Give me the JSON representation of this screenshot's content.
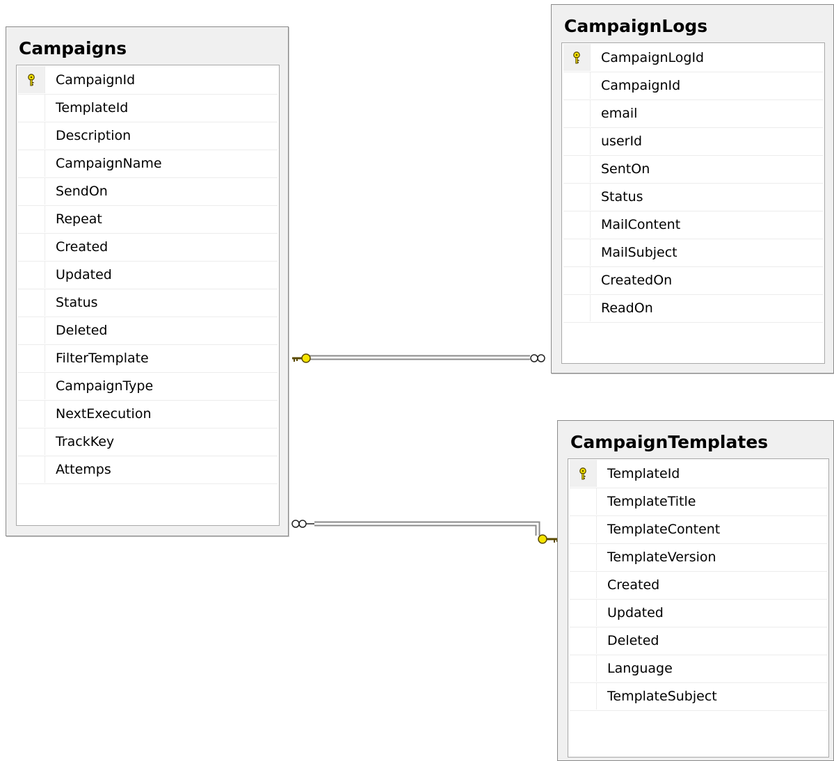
{
  "tables": {
    "campaigns": {
      "title": "Campaigns",
      "columns": [
        {
          "name": "CampaignId",
          "pk": true
        },
        {
          "name": "TemplateId",
          "pk": false
        },
        {
          "name": "Description",
          "pk": false
        },
        {
          "name": "CampaignName",
          "pk": false
        },
        {
          "name": "SendOn",
          "pk": false
        },
        {
          "name": "Repeat",
          "pk": false
        },
        {
          "name": "Created",
          "pk": false
        },
        {
          "name": "Updated",
          "pk": false
        },
        {
          "name": "Status",
          "pk": false
        },
        {
          "name": "Deleted",
          "pk": false
        },
        {
          "name": "FilterTemplate",
          "pk": false
        },
        {
          "name": "CampaignType",
          "pk": false
        },
        {
          "name": "NextExecution",
          "pk": false
        },
        {
          "name": "TrackKey",
          "pk": false
        },
        {
          "name": "Attemps",
          "pk": false
        }
      ]
    },
    "campaign_logs": {
      "title": "CampaignLogs",
      "columns": [
        {
          "name": "CampaignLogId",
          "pk": true
        },
        {
          "name": "CampaignId",
          "pk": false
        },
        {
          "name": "email",
          "pk": false
        },
        {
          "name": "userId",
          "pk": false
        },
        {
          "name": "SentOn",
          "pk": false
        },
        {
          "name": "Status",
          "pk": false
        },
        {
          "name": "MailContent",
          "pk": false
        },
        {
          "name": "MailSubject",
          "pk": false
        },
        {
          "name": "CreatedOn",
          "pk": false
        },
        {
          "name": "ReadOn",
          "pk": false
        }
      ]
    },
    "campaign_templates": {
      "title": "CampaignTemplates",
      "columns": [
        {
          "name": "TemplateId",
          "pk": true
        },
        {
          "name": "TemplateTitle",
          "pk": false
        },
        {
          "name": "TemplateContent",
          "pk": false
        },
        {
          "name": "TemplateVersion",
          "pk": false
        },
        {
          "name": "Created",
          "pk": false
        },
        {
          "name": "Updated",
          "pk": false
        },
        {
          "name": "Deleted",
          "pk": false
        },
        {
          "name": "Language",
          "pk": false
        },
        {
          "name": "TemplateSubject",
          "pk": false
        }
      ]
    }
  },
  "relationships": [
    {
      "from": "Campaigns",
      "to": "CampaignLogs",
      "one_end": "key-icon",
      "many_end": "infinity-icon"
    },
    {
      "from": "CampaignTemplates",
      "to": "Campaigns",
      "one_end": "key-icon",
      "many_end": "infinity-icon"
    }
  ],
  "colors": {
    "key_fill": "#f5e400",
    "key_stroke": "#5a4a00",
    "line": "#8a8a8a"
  }
}
